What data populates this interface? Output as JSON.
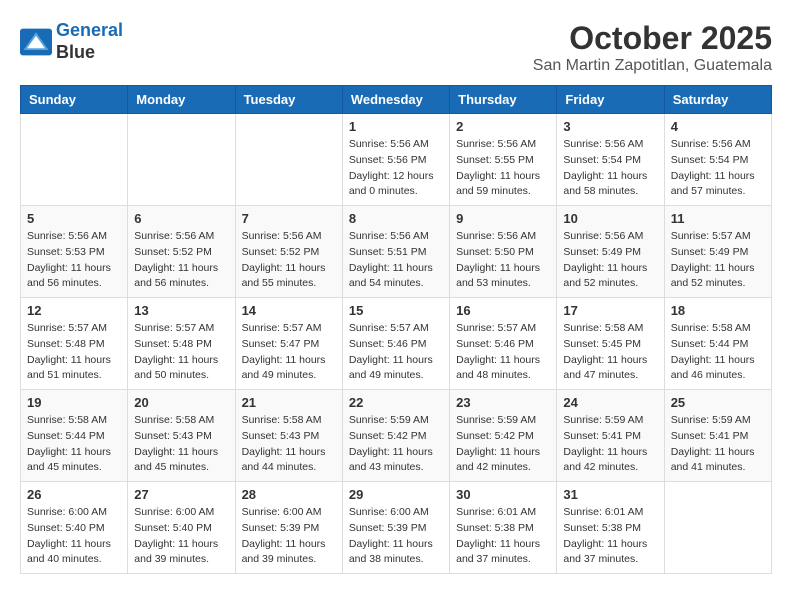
{
  "header": {
    "logo_line1": "General",
    "logo_line2": "Blue",
    "month": "October 2025",
    "location": "San Martin Zapotitlan, Guatemala"
  },
  "weekdays": [
    "Sunday",
    "Monday",
    "Tuesday",
    "Wednesday",
    "Thursday",
    "Friday",
    "Saturday"
  ],
  "weeks": [
    [
      {
        "day": "",
        "info": ""
      },
      {
        "day": "",
        "info": ""
      },
      {
        "day": "",
        "info": ""
      },
      {
        "day": "1",
        "info": "Sunrise: 5:56 AM\nSunset: 5:56 PM\nDaylight: 12 hours\nand 0 minutes."
      },
      {
        "day": "2",
        "info": "Sunrise: 5:56 AM\nSunset: 5:55 PM\nDaylight: 11 hours\nand 59 minutes."
      },
      {
        "day": "3",
        "info": "Sunrise: 5:56 AM\nSunset: 5:54 PM\nDaylight: 11 hours\nand 58 minutes."
      },
      {
        "day": "4",
        "info": "Sunrise: 5:56 AM\nSunset: 5:54 PM\nDaylight: 11 hours\nand 57 minutes."
      }
    ],
    [
      {
        "day": "5",
        "info": "Sunrise: 5:56 AM\nSunset: 5:53 PM\nDaylight: 11 hours\nand 56 minutes."
      },
      {
        "day": "6",
        "info": "Sunrise: 5:56 AM\nSunset: 5:52 PM\nDaylight: 11 hours\nand 56 minutes."
      },
      {
        "day": "7",
        "info": "Sunrise: 5:56 AM\nSunset: 5:52 PM\nDaylight: 11 hours\nand 55 minutes."
      },
      {
        "day": "8",
        "info": "Sunrise: 5:56 AM\nSunset: 5:51 PM\nDaylight: 11 hours\nand 54 minutes."
      },
      {
        "day": "9",
        "info": "Sunrise: 5:56 AM\nSunset: 5:50 PM\nDaylight: 11 hours\nand 53 minutes."
      },
      {
        "day": "10",
        "info": "Sunrise: 5:56 AM\nSunset: 5:49 PM\nDaylight: 11 hours\nand 52 minutes."
      },
      {
        "day": "11",
        "info": "Sunrise: 5:57 AM\nSunset: 5:49 PM\nDaylight: 11 hours\nand 52 minutes."
      }
    ],
    [
      {
        "day": "12",
        "info": "Sunrise: 5:57 AM\nSunset: 5:48 PM\nDaylight: 11 hours\nand 51 minutes."
      },
      {
        "day": "13",
        "info": "Sunrise: 5:57 AM\nSunset: 5:48 PM\nDaylight: 11 hours\nand 50 minutes."
      },
      {
        "day": "14",
        "info": "Sunrise: 5:57 AM\nSunset: 5:47 PM\nDaylight: 11 hours\nand 49 minutes."
      },
      {
        "day": "15",
        "info": "Sunrise: 5:57 AM\nSunset: 5:46 PM\nDaylight: 11 hours\nand 49 minutes."
      },
      {
        "day": "16",
        "info": "Sunrise: 5:57 AM\nSunset: 5:46 PM\nDaylight: 11 hours\nand 48 minutes."
      },
      {
        "day": "17",
        "info": "Sunrise: 5:58 AM\nSunset: 5:45 PM\nDaylight: 11 hours\nand 47 minutes."
      },
      {
        "day": "18",
        "info": "Sunrise: 5:58 AM\nSunset: 5:44 PM\nDaylight: 11 hours\nand 46 minutes."
      }
    ],
    [
      {
        "day": "19",
        "info": "Sunrise: 5:58 AM\nSunset: 5:44 PM\nDaylight: 11 hours\nand 45 minutes."
      },
      {
        "day": "20",
        "info": "Sunrise: 5:58 AM\nSunset: 5:43 PM\nDaylight: 11 hours\nand 45 minutes."
      },
      {
        "day": "21",
        "info": "Sunrise: 5:58 AM\nSunset: 5:43 PM\nDaylight: 11 hours\nand 44 minutes."
      },
      {
        "day": "22",
        "info": "Sunrise: 5:59 AM\nSunset: 5:42 PM\nDaylight: 11 hours\nand 43 minutes."
      },
      {
        "day": "23",
        "info": "Sunrise: 5:59 AM\nSunset: 5:42 PM\nDaylight: 11 hours\nand 42 minutes."
      },
      {
        "day": "24",
        "info": "Sunrise: 5:59 AM\nSunset: 5:41 PM\nDaylight: 11 hours\nand 42 minutes."
      },
      {
        "day": "25",
        "info": "Sunrise: 5:59 AM\nSunset: 5:41 PM\nDaylight: 11 hours\nand 41 minutes."
      }
    ],
    [
      {
        "day": "26",
        "info": "Sunrise: 6:00 AM\nSunset: 5:40 PM\nDaylight: 11 hours\nand 40 minutes."
      },
      {
        "day": "27",
        "info": "Sunrise: 6:00 AM\nSunset: 5:40 PM\nDaylight: 11 hours\nand 39 minutes."
      },
      {
        "day": "28",
        "info": "Sunrise: 6:00 AM\nSunset: 5:39 PM\nDaylight: 11 hours\nand 39 minutes."
      },
      {
        "day": "29",
        "info": "Sunrise: 6:00 AM\nSunset: 5:39 PM\nDaylight: 11 hours\nand 38 minutes."
      },
      {
        "day": "30",
        "info": "Sunrise: 6:01 AM\nSunset: 5:38 PM\nDaylight: 11 hours\nand 37 minutes."
      },
      {
        "day": "31",
        "info": "Sunrise: 6:01 AM\nSunset: 5:38 PM\nDaylight: 11 hours\nand 37 minutes."
      },
      {
        "day": "",
        "info": ""
      }
    ]
  ]
}
